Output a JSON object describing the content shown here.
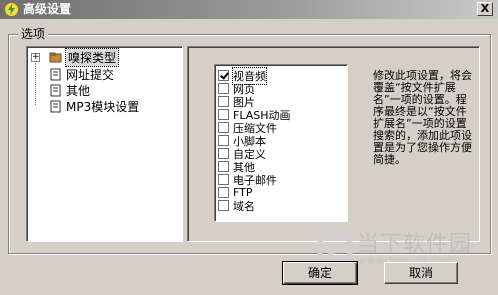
{
  "window": {
    "title": "高级设置",
    "close_label": "X"
  },
  "group": {
    "label": "选项"
  },
  "tree": {
    "expander": "+",
    "items": [
      {
        "label": "嗅探类型",
        "selected": true
      },
      {
        "label": "网址提交"
      },
      {
        "label": "其他"
      },
      {
        "label": "MP3模块设置"
      }
    ]
  },
  "options": [
    {
      "label": "视音频",
      "checked": true
    },
    {
      "label": "网页",
      "checked": false
    },
    {
      "label": "图片",
      "checked": false
    },
    {
      "label": "FLASH动画",
      "checked": false
    },
    {
      "label": "压缩文件",
      "checked": false
    },
    {
      "label": "小脚本",
      "checked": false
    },
    {
      "label": "自定义",
      "checked": false
    },
    {
      "label": "其他",
      "checked": false
    },
    {
      "label": "电子邮件",
      "checked": false
    },
    {
      "label": "FTP",
      "checked": false
    },
    {
      "label": "域名",
      "checked": false
    }
  ],
  "description": "修改此项设置，将会覆盖“按文件扩展名”一项的设置。程序最终是以“按文件扩展名”一项的设置搜索的，添加此项设置是为了您操作方便简捷。",
  "buttons": {
    "ok": "确定",
    "cancel": "取消"
  },
  "watermark": {
    "text": "当下软件园",
    "sub": "www.downxia.com"
  }
}
